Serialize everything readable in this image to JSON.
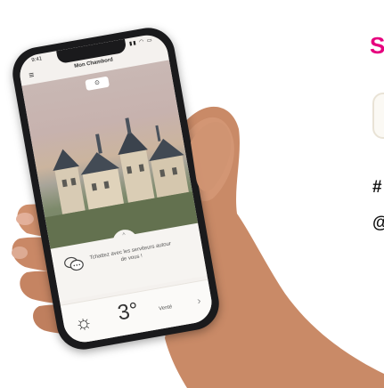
{
  "app": {
    "title": "Mon Chambord",
    "status_time": "9:41",
    "status_icons": "▮▮ ◠ ▭",
    "menu_icon": "menu-icon",
    "camera_badge": "⊙"
  },
  "feature": {
    "text": "Tchattez avec les serviteurs autour de vous !"
  },
  "weather": {
    "icon": "sun-icon",
    "temperature": "3°",
    "condition": "Venté",
    "chevron": "›"
  },
  "side": {
    "title_letter": "S",
    "hash": "#",
    "at": "@"
  },
  "colors": {
    "accent": "#e6007e"
  }
}
